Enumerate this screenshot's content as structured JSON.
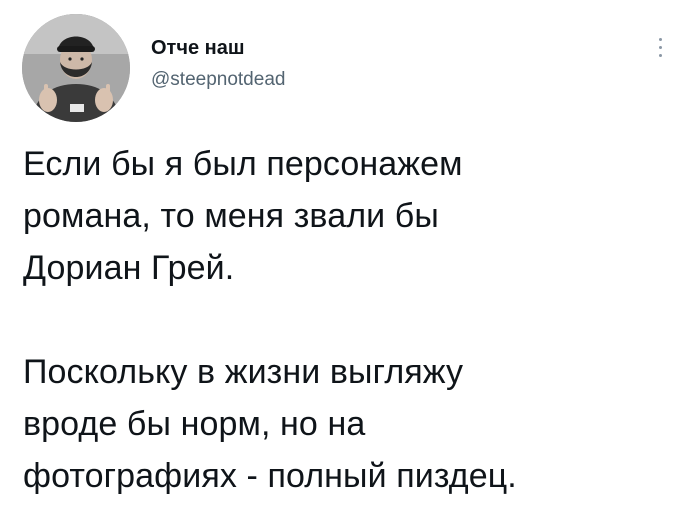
{
  "user": {
    "display_name": "Отче наш",
    "handle": "@steepnotdead",
    "avatar_icon": "user-avatar-photo"
  },
  "tweet": {
    "paragraph_1": [
      "Если бы я был персонажем",
      "романа, то меня звали бы",
      "Дориан Грей."
    ],
    "paragraph_2": [
      "Поскольку в жизни выгляжу",
      "вроде бы норм, но на",
      "фотографиях - полный пиздец."
    ]
  },
  "more_icon": "more-vertical-icon",
  "colors": {
    "text": "#0f1419",
    "secondary": "#536471",
    "icon": "#8b98a5",
    "background": "#ffffff"
  }
}
